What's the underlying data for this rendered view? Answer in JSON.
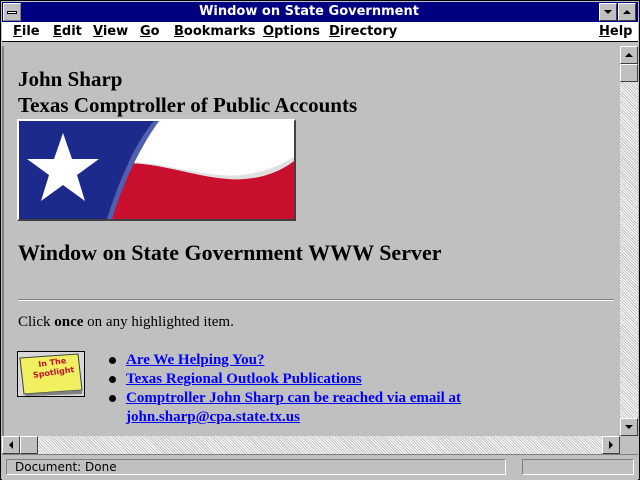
{
  "window": {
    "title": "Window on State Government"
  },
  "menu": {
    "items": [
      "File",
      "Edit",
      "View",
      "Go",
      "Bookmarks",
      "Options",
      "Directory"
    ],
    "help": "Help"
  },
  "page": {
    "heading_name": "John Sharp",
    "heading_title": "Texas Comptroller of Public Accounts",
    "server_heading": "Window on State Government WWW Server",
    "click_prefix": "Click",
    "click_bold": "once",
    "click_suffix": "on any highlighted item.",
    "spotlight_text": "In The Spotlight",
    "links": [
      "Are We Helping You?",
      "Texas Regional Outlook Publications",
      "Comptroller John Sharp can be reached via email at john.sharp@cpa.state.tx.us"
    ]
  },
  "status": {
    "text": "Document: Done"
  },
  "colors": {
    "titlebar": "#000080",
    "window_bg": "#c0c0c0",
    "link": "#0000ff",
    "flag_blue": "#1c2a8c",
    "flag_red": "#c8102e",
    "spotlight_bg": "#f0f060"
  }
}
